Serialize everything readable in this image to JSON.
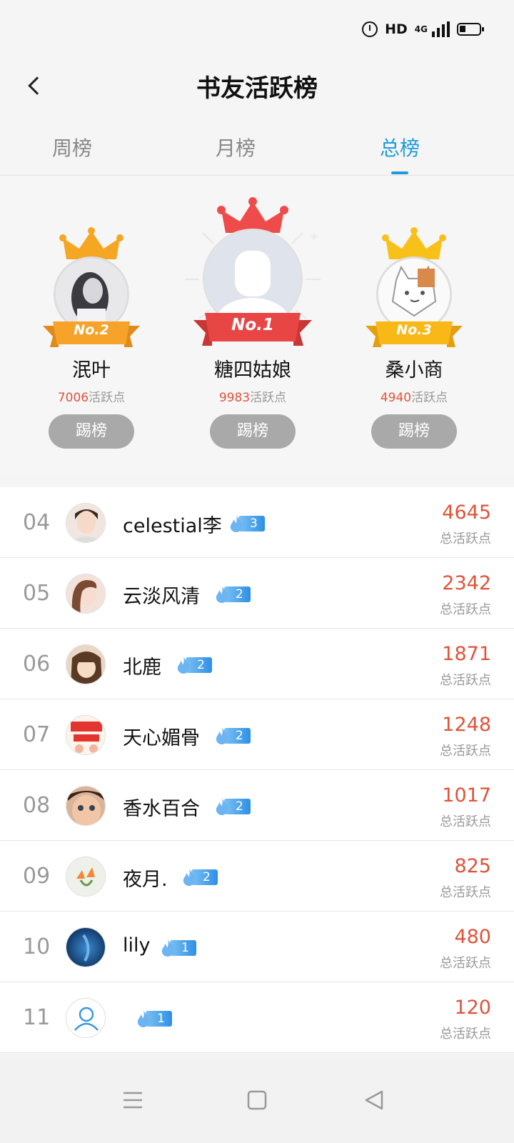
{
  "header": {
    "title": "书友活跃榜"
  },
  "tabs": [
    {
      "label": "周榜",
      "active": false
    },
    {
      "label": "月榜",
      "active": false
    },
    {
      "label": "总榜",
      "active": true
    }
  ],
  "podium": [
    {
      "badge": "No.2",
      "name": "泯叶",
      "points": "7006",
      "points_label": "活跃点",
      "kick_label": "踢榜",
      "crown_color": "#f5a623",
      "ribbon_color": "#f7a32a"
    },
    {
      "badge": "No.1",
      "name": "糖四姑娘",
      "points": "9983",
      "points_label": "活跃点",
      "kick_label": "踢榜",
      "crown_color": "#ef4b4b",
      "ribbon_color": "#e84545"
    },
    {
      "badge": "No.3",
      "name": "桑小商",
      "points": "4940",
      "points_label": "活跃点",
      "kick_label": "踢榜",
      "crown_color": "#f8c11a",
      "ribbon_color": "#f8b918"
    }
  ],
  "list": [
    {
      "rank": "04",
      "name": "celestial李",
      "level": "3",
      "points": "4645",
      "points_label": "总活跃点"
    },
    {
      "rank": "05",
      "name": "云淡风清",
      "level": "2",
      "points": "2342",
      "points_label": "总活跃点"
    },
    {
      "rank": "06",
      "name": "北鹿",
      "level": "2",
      "points": "1871",
      "points_label": "总活跃点"
    },
    {
      "rank": "07",
      "name": "天心媚骨",
      "level": "2",
      "points": "1248",
      "points_label": "总活跃点"
    },
    {
      "rank": "08",
      "name": "香水百合",
      "level": "2",
      "points": "1017",
      "points_label": "总活跃点"
    },
    {
      "rank": "09",
      "name": "夜月.",
      "level": "2",
      "points": "825",
      "points_label": "总活跃点"
    },
    {
      "rank": "10",
      "name": "lily",
      "level": "1",
      "points": "480",
      "points_label": "总活跃点"
    },
    {
      "rank": "11",
      "name": "",
      "level": "1",
      "points": "120",
      "points_label": "总活跃点"
    }
  ],
  "status_bar": {
    "hd": "HD",
    "network": "4G"
  },
  "colors": {
    "accent": "#1f9bdc",
    "points": "#e0533b",
    "kick_button": "#a9a9a9"
  }
}
